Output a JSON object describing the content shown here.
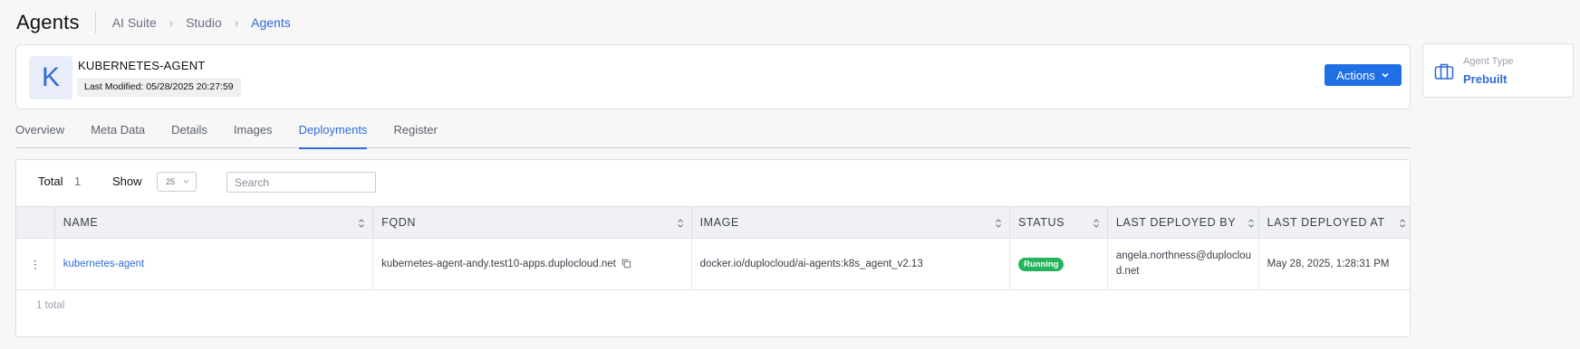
{
  "header": {
    "title": "Agents",
    "breadcrumbs": [
      "AI Suite",
      "Studio",
      "Agents"
    ]
  },
  "agent": {
    "avatar_letter": "K",
    "name": "KUBERNETES-AGENT",
    "last_modified": "Last Modified: 05/28/2025 20:27:59",
    "actions_label": "Actions"
  },
  "agent_type": {
    "label": "Agent Type",
    "value": "Prebuilt",
    "icon": "briefcase-icon"
  },
  "tabs": [
    {
      "label": "Overview",
      "active": false
    },
    {
      "label": "Meta Data",
      "active": false
    },
    {
      "label": "Details",
      "active": false
    },
    {
      "label": "Images",
      "active": false
    },
    {
      "label": "Deployments",
      "active": true
    },
    {
      "label": "Register",
      "active": false
    }
  ],
  "toolbar": {
    "total_label": "Total",
    "total_value": "1",
    "show_label": "Show",
    "show_value": "25",
    "search_placeholder": "Search"
  },
  "table": {
    "columns": [
      "NAME",
      "FQDN",
      "IMAGE",
      "STATUS",
      "LAST DEPLOYED BY",
      "LAST DEPLOYED AT"
    ],
    "rows": [
      {
        "name": "kubernetes-agent",
        "fqdn": "kubernetes-agent-andy.test10-apps.duplocloud.net",
        "image": "docker.io/duplocloud/ai-agents:k8s_agent_v2.13",
        "status": "Running",
        "deployed_by": "angela.northness@duplocloud.net",
        "deployed_at": "May 28, 2025, 1:28:31 PM"
      }
    ],
    "footer": "1 total"
  },
  "colors": {
    "accent": "#2f6bd8",
    "button": "#1f6fe5",
    "status_running": "#24b45b"
  }
}
